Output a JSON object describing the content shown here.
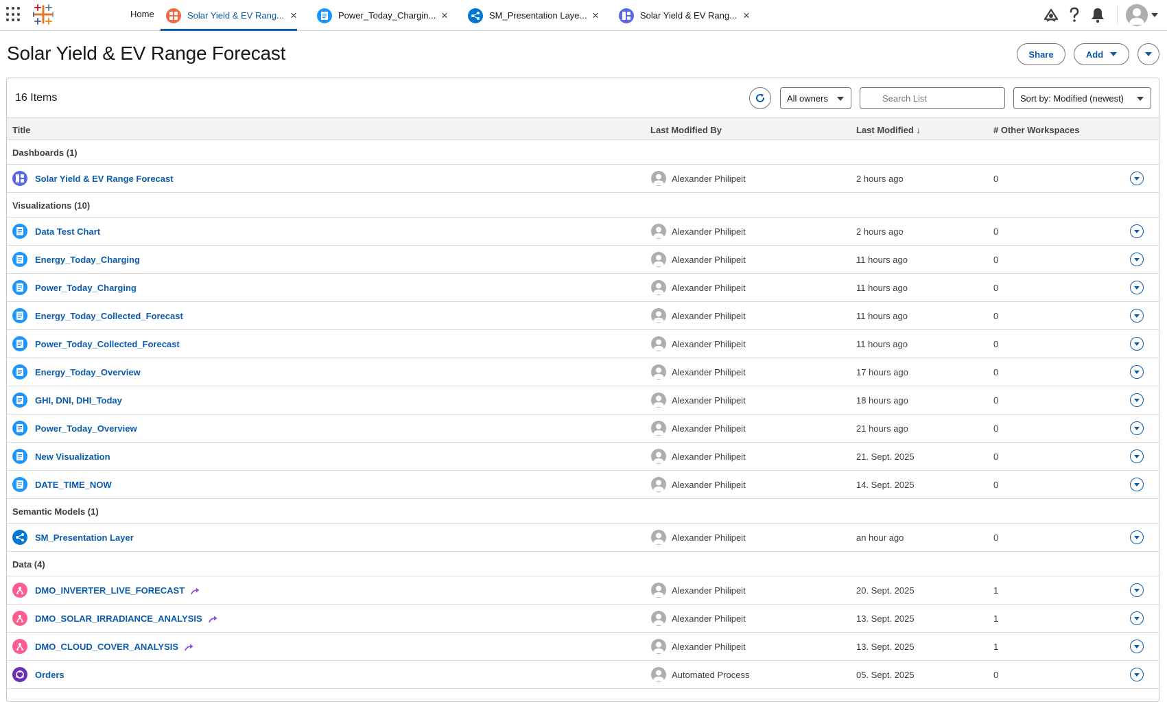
{
  "topbar": {
    "home_label": "Home",
    "tabs": [
      {
        "label": "Solar Yield & EV Rang...",
        "icon": "dashboard-icon",
        "color": "#f06a45",
        "active": true
      },
      {
        "label": "Power_Today_Chargin...",
        "icon": "visualization-icon",
        "color": "#1b96ff",
        "active": false
      },
      {
        "label": "SM_Presentation Laye...",
        "icon": "semantic-model-icon",
        "color": "#0176d3",
        "active": false
      },
      {
        "label": "Solar Yield & EV Rang...",
        "icon": "dashboard-icon",
        "color": "#5867e8",
        "active": false
      }
    ],
    "close_glyph": "×",
    "icons": [
      "connect-icon",
      "help-icon",
      "notifications-icon",
      "user-avatar-icon"
    ]
  },
  "page": {
    "title": "Solar Yield & EV Range Forecast",
    "share_label": "Share",
    "add_label": "Add"
  },
  "list": {
    "count_label": "16 Items",
    "owners_filter": "All owners",
    "search_placeholder": "Search List",
    "sort_label": "Sort by: Modified (newest)",
    "columns": {
      "title": "Title",
      "modified_by": "Last Modified By",
      "last_modified": "Last Modified",
      "sort_arrow": "↓",
      "other_workspaces": "# Other Workspaces"
    }
  },
  "sections": [
    {
      "label": "Dashboards (1)",
      "items": [
        {
          "title": "Solar Yield & EV Range Forecast",
          "type": "dashboard",
          "user": "Alexander Philipeit",
          "modified": "2 hours ago",
          "workspaces": "0",
          "external": false
        }
      ]
    },
    {
      "label": "Visualizations (10)",
      "items": [
        {
          "title": "Data Test Chart",
          "type": "visualization",
          "user": "Alexander Philipeit",
          "modified": "2 hours ago",
          "workspaces": "0",
          "external": false
        },
        {
          "title": "Energy_Today_Charging",
          "type": "visualization",
          "user": "Alexander Philipeit",
          "modified": "11 hours ago",
          "workspaces": "0",
          "external": false
        },
        {
          "title": "Power_Today_Charging",
          "type": "visualization",
          "user": "Alexander Philipeit",
          "modified": "11 hours ago",
          "workspaces": "0",
          "external": false
        },
        {
          "title": "Energy_Today_Collected_Forecast",
          "type": "visualization",
          "user": "Alexander Philipeit",
          "modified": "11 hours ago",
          "workspaces": "0",
          "external": false
        },
        {
          "title": "Power_Today_Collected_Forecast",
          "type": "visualization",
          "user": "Alexander Philipeit",
          "modified": "11 hours ago",
          "workspaces": "0",
          "external": false
        },
        {
          "title": "Energy_Today_Overview",
          "type": "visualization",
          "user": "Alexander Philipeit",
          "modified": "17 hours ago",
          "workspaces": "0",
          "external": false
        },
        {
          "title": "GHI, DNI, DHI_Today",
          "type": "visualization",
          "user": "Alexander Philipeit",
          "modified": "18 hours ago",
          "workspaces": "0",
          "external": false
        },
        {
          "title": "Power_Today_Overview",
          "type": "visualization",
          "user": "Alexander Philipeit",
          "modified": "21 hours ago",
          "workspaces": "0",
          "external": false
        },
        {
          "title": "New Visualization",
          "type": "visualization",
          "user": "Alexander Philipeit",
          "modified": "21. Sept. 2025",
          "workspaces": "0",
          "external": false
        },
        {
          "title": "DATE_TIME_NOW",
          "type": "visualization",
          "user": "Alexander Philipeit",
          "modified": "14. Sept. 2025",
          "workspaces": "0",
          "external": false
        }
      ]
    },
    {
      "label": "Semantic Models (1)",
      "items": [
        {
          "title": "SM_Presentation Layer",
          "type": "semantic",
          "user": "Alexander Philipeit",
          "modified": "an hour ago",
          "workspaces": "0",
          "external": false
        }
      ]
    },
    {
      "label": "Data (4)",
      "items": [
        {
          "title": "DMO_INVERTER_LIVE_FORECAST",
          "type": "dmo",
          "user": "Alexander Philipeit",
          "modified": "20. Sept. 2025",
          "workspaces": "1",
          "external": true
        },
        {
          "title": "DMO_SOLAR_IRRADIANCE_ANALYSIS",
          "type": "dmo",
          "user": "Alexander Philipeit",
          "modified": "13. Sept. 2025",
          "workspaces": "1",
          "external": true
        },
        {
          "title": "DMO_CLOUD_COVER_ANALYSIS",
          "type": "dmo",
          "user": "Alexander Philipeit",
          "modified": "13. Sept. 2025",
          "workspaces": "1",
          "external": true
        },
        {
          "title": "Orders",
          "type": "dataset",
          "user": "Automated Process",
          "modified": "05. Sept. 2025",
          "workspaces": "0",
          "external": false
        }
      ]
    }
  ],
  "colors": {
    "link": "#0b5cab",
    "dashboard_row_icon": "#5867e8",
    "visualization_icon": "#1b96ff",
    "semantic_icon": "#0176d3",
    "dmo_icon": "#ff5d8f",
    "dataset_icon": "#6b2fb3",
    "external_arrow": "#9050e9"
  }
}
